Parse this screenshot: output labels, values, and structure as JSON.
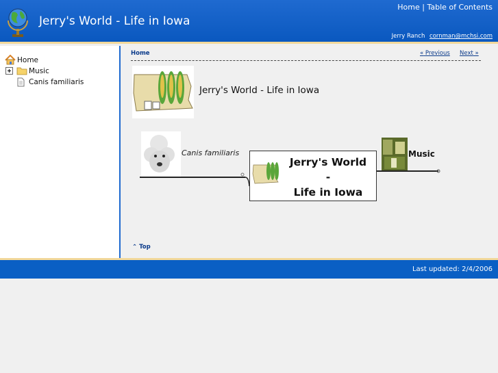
{
  "header": {
    "title": "Jerry's World - Life in Iowa",
    "links": {
      "home": "Home",
      "separator": "|",
      "toc": "Table of Contents"
    },
    "author": "Jerry Ranch",
    "email": "cornman@mchsi.com"
  },
  "sidebar": {
    "items": [
      {
        "label": "Home"
      },
      {
        "label": "Music"
      },
      {
        "label": "Canis familiaris"
      }
    ]
  },
  "main": {
    "breadcrumb": "Home",
    "previous": "Previous",
    "next": "Next",
    "heading": "Jerry's World - Life in Iowa",
    "map": {
      "center": {
        "line1": "Jerry's World",
        "line2": "-",
        "line3": "Life in Iowa"
      },
      "left_branch": "Canis familiaris",
      "right_branch": "Music"
    },
    "top_link": "Top"
  },
  "footer": {
    "updated": "Last updated: 2/4/2006"
  },
  "colors": {
    "header_blue": "#0a58bf",
    "accent_gold": "#f2d89a",
    "link": "#0a3a8a"
  }
}
